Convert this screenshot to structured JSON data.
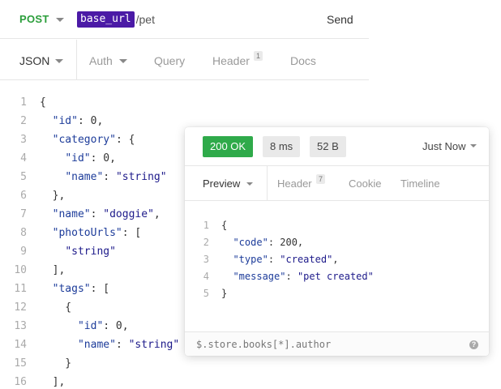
{
  "request": {
    "method": "POST",
    "url_variable": "base_url",
    "url_path": "/pet",
    "send_label": "Send"
  },
  "request_tabs": {
    "json": "JSON",
    "auth": "Auth",
    "query": "Query",
    "header": "Header",
    "header_count": "1",
    "docs": "Docs"
  },
  "editor_lines": [
    {
      "n": "1",
      "text": "{"
    },
    {
      "n": "2",
      "text": "  \"id\": 0,"
    },
    {
      "n": "3",
      "text": "  \"category\": {"
    },
    {
      "n": "4",
      "text": "    \"id\": 0,"
    },
    {
      "n": "5",
      "text": "    \"name\": \"string\""
    },
    {
      "n": "6",
      "text": "  },"
    },
    {
      "n": "7",
      "text": "  \"name\": \"doggie\","
    },
    {
      "n": "8",
      "text": "  \"photoUrls\": ["
    },
    {
      "n": "9",
      "text": "    \"string\""
    },
    {
      "n": "10",
      "text": "  ],"
    },
    {
      "n": "11",
      "text": "  \"tags\": ["
    },
    {
      "n": "12",
      "text": "    {"
    },
    {
      "n": "13",
      "text": "      \"id\": 0,"
    },
    {
      "n": "14",
      "text": "      \"name\": \"string\""
    },
    {
      "n": "15",
      "text": "    }"
    },
    {
      "n": "16",
      "text": "  ],"
    }
  ],
  "response": {
    "status": "200 OK",
    "time": "8 ms",
    "size": "52 B",
    "when": "Just Now",
    "status_color": "#2faa4a",
    "tabs": {
      "preview": "Preview",
      "header": "Header",
      "header_count": "7",
      "cookie": "Cookie",
      "timeline": "Timeline"
    },
    "body_lines": [
      {
        "n": "1",
        "text": "{"
      },
      {
        "n": "2",
        "text": "  \"code\": 200,"
      },
      {
        "n": "3",
        "text": "  \"type\": \"created\","
      },
      {
        "n": "4",
        "text": "  \"message\": \"pet created\""
      },
      {
        "n": "5",
        "text": "}"
      }
    ],
    "filter_placeholder": "$.store.books[*].author",
    "help_icon": "?"
  },
  "colors": {
    "method": "#2b9e3b",
    "variable_bg": "#4b1aa6",
    "json_key": "#1d3c9a",
    "json_string": "#1d1a8a"
  }
}
